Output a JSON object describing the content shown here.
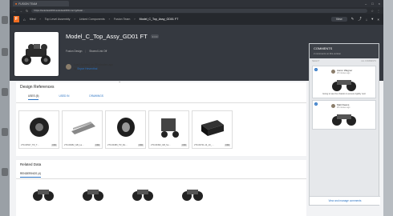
{
  "browser": {
    "tab_title": "FUSION TEAM",
    "url": "https://autodesk360.autodesk360.com/g/data/…",
    "window_controls": [
      "–",
      "□",
      "×"
    ]
  },
  "app": {
    "logo": "F",
    "breadcrumbs": [
      "Mind",
      "Top Level Assembly",
      "Linked Components",
      "Fusion Team",
      "Model_C_Top_Assy_GD01 FT"
    ],
    "view_label": "View"
  },
  "item": {
    "title": "Model_C_Top_Assy_GD01 FT",
    "menu": "• • •",
    "sub": [
      "Fusion Design",
      "Shared Link Off"
    ],
    "last_updated_prefix": "Last Updated on",
    "last_updated_when": "28 minutes ago",
    "by_prefix": "by",
    "by_user": "Bryce Heventhal"
  },
  "design_refs": {
    "heading": "Design References",
    "tabs": [
      "USES (5)",
      "USED IN",
      "DRAWINGS"
    ],
    "items": [
      {
        "label": "2T0-00527_TR_T…",
        "ext": "F3D"
      },
      {
        "label": "2T0-00082_GB_La…",
        "ext": "F3D"
      },
      {
        "label": "2T0-00489_TR_Ro…",
        "ext": "F3D"
      },
      {
        "label": "2T0-00490_GB_Su…",
        "ext": "F3D"
      },
      {
        "label": "2T0-00741-14_10_…",
        "ext": "F3D"
      }
    ]
  },
  "related": {
    "heading": "Related Data",
    "tab": "RENDERINGS (4)"
  },
  "comments": {
    "title": "COMMENTS",
    "subtitle": "2 comments on this version",
    "col_left": "SELECT",
    "col_right": "ALL COMMENTS",
    "items": [
      {
        "num": "1",
        "user": "Aaron Wagner",
        "date": "28 minutes ago",
        "text": "Going to see the chassis to ensure rigidity next"
      },
      {
        "num": "2",
        "user": "Matt Deans",
        "date": "28 minutes ago",
        "text": ""
      }
    ],
    "footer": "View and manage comments"
  },
  "colors": {
    "accent": "#2a73c4",
    "brand": "#f26d21",
    "header_bg": "#353940"
  }
}
